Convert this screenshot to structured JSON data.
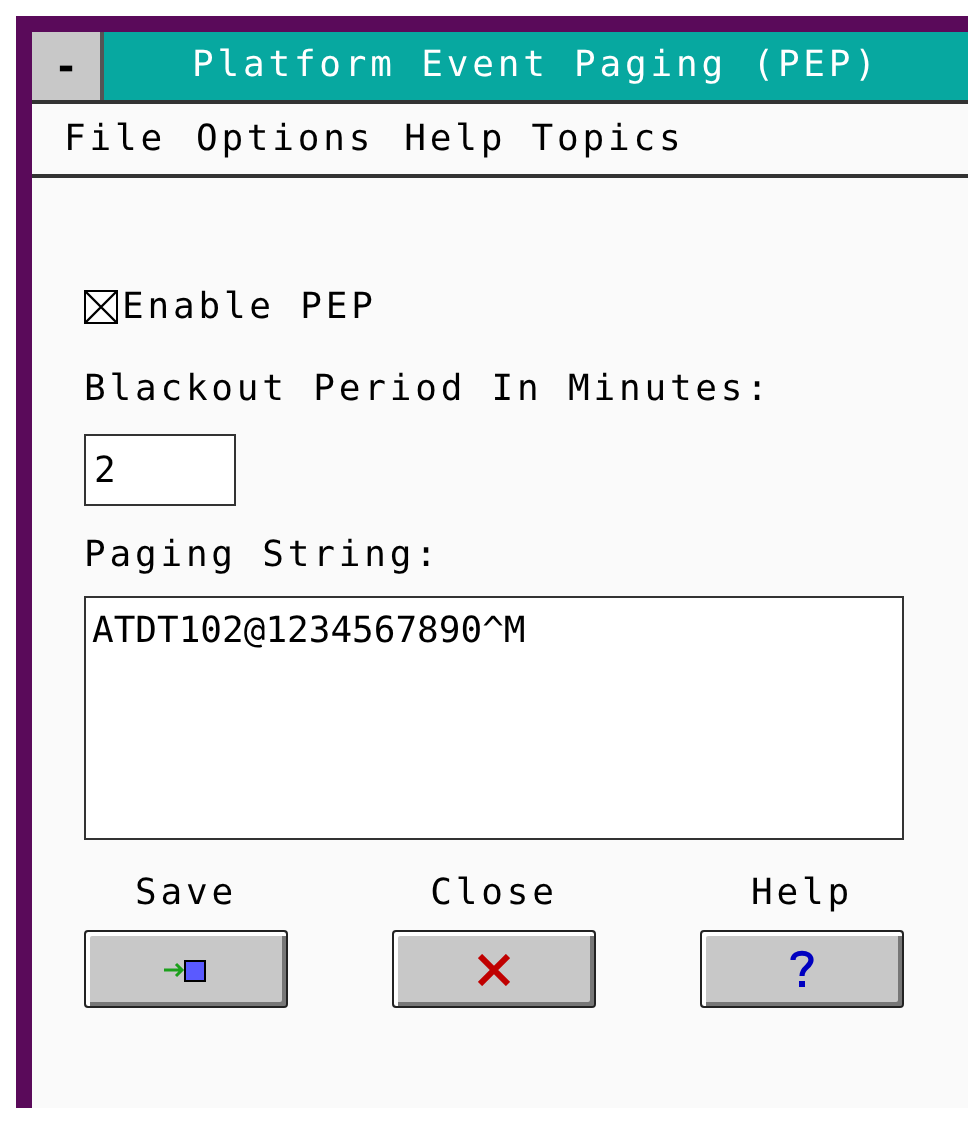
{
  "window": {
    "title": "Platform Event Paging (PEP)",
    "system_menu": "-"
  },
  "menu": [
    {
      "label": "File"
    },
    {
      "label": "Options"
    },
    {
      "label": "Help Topics"
    }
  ],
  "enable": {
    "label": "Enable PEP",
    "checked": true
  },
  "blackout": {
    "label": "Blackout Period In Minutes:",
    "value": "2"
  },
  "paging": {
    "label": "Paging String:",
    "value": "ATDT102@1234567890^M"
  },
  "buttons": [
    {
      "caption": "Save",
      "kind": "save"
    },
    {
      "caption": "Close",
      "kind": "close"
    },
    {
      "caption": "Help",
      "kind": "help"
    }
  ]
}
